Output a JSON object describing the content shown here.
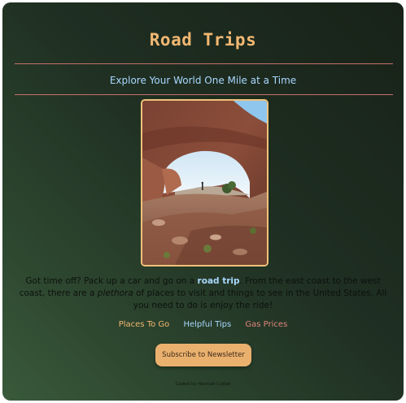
{
  "header": {
    "title": "Road Trips",
    "tagline": "Explore Your World One Mile at a Time"
  },
  "hero_image": {
    "description": "red rock natural arch with a lone hiker under the span, blue sky behind"
  },
  "intro": {
    "part1": "Got time off? Pack up a car and go on a ",
    "keyword": "road trip",
    "part2": ". From the east coast to the west coast, there are a ",
    "emphasis": "plethora",
    "part3": " of places to visit and things to see in the United States. All you need to do is enjoy the ride!"
  },
  "nav": {
    "links": [
      {
        "label": "Places To Go",
        "color": "#f2b872"
      },
      {
        "label": "Helpful Tips",
        "color": "#a9d8ff"
      },
      {
        "label": "Gas Prices",
        "color": "#e0847a"
      }
    ]
  },
  "subscribe": {
    "label": "Subscribe to Newsletter"
  },
  "footer": {
    "credit": "Coded by Hannah Cottar"
  },
  "colors": {
    "accent_orange": "#f2b872",
    "accent_blue": "#a9d8ff",
    "accent_red": "#e0847a",
    "rule": "#c8706a",
    "frame": "#f0c27a",
    "button": "#eab06e"
  }
}
